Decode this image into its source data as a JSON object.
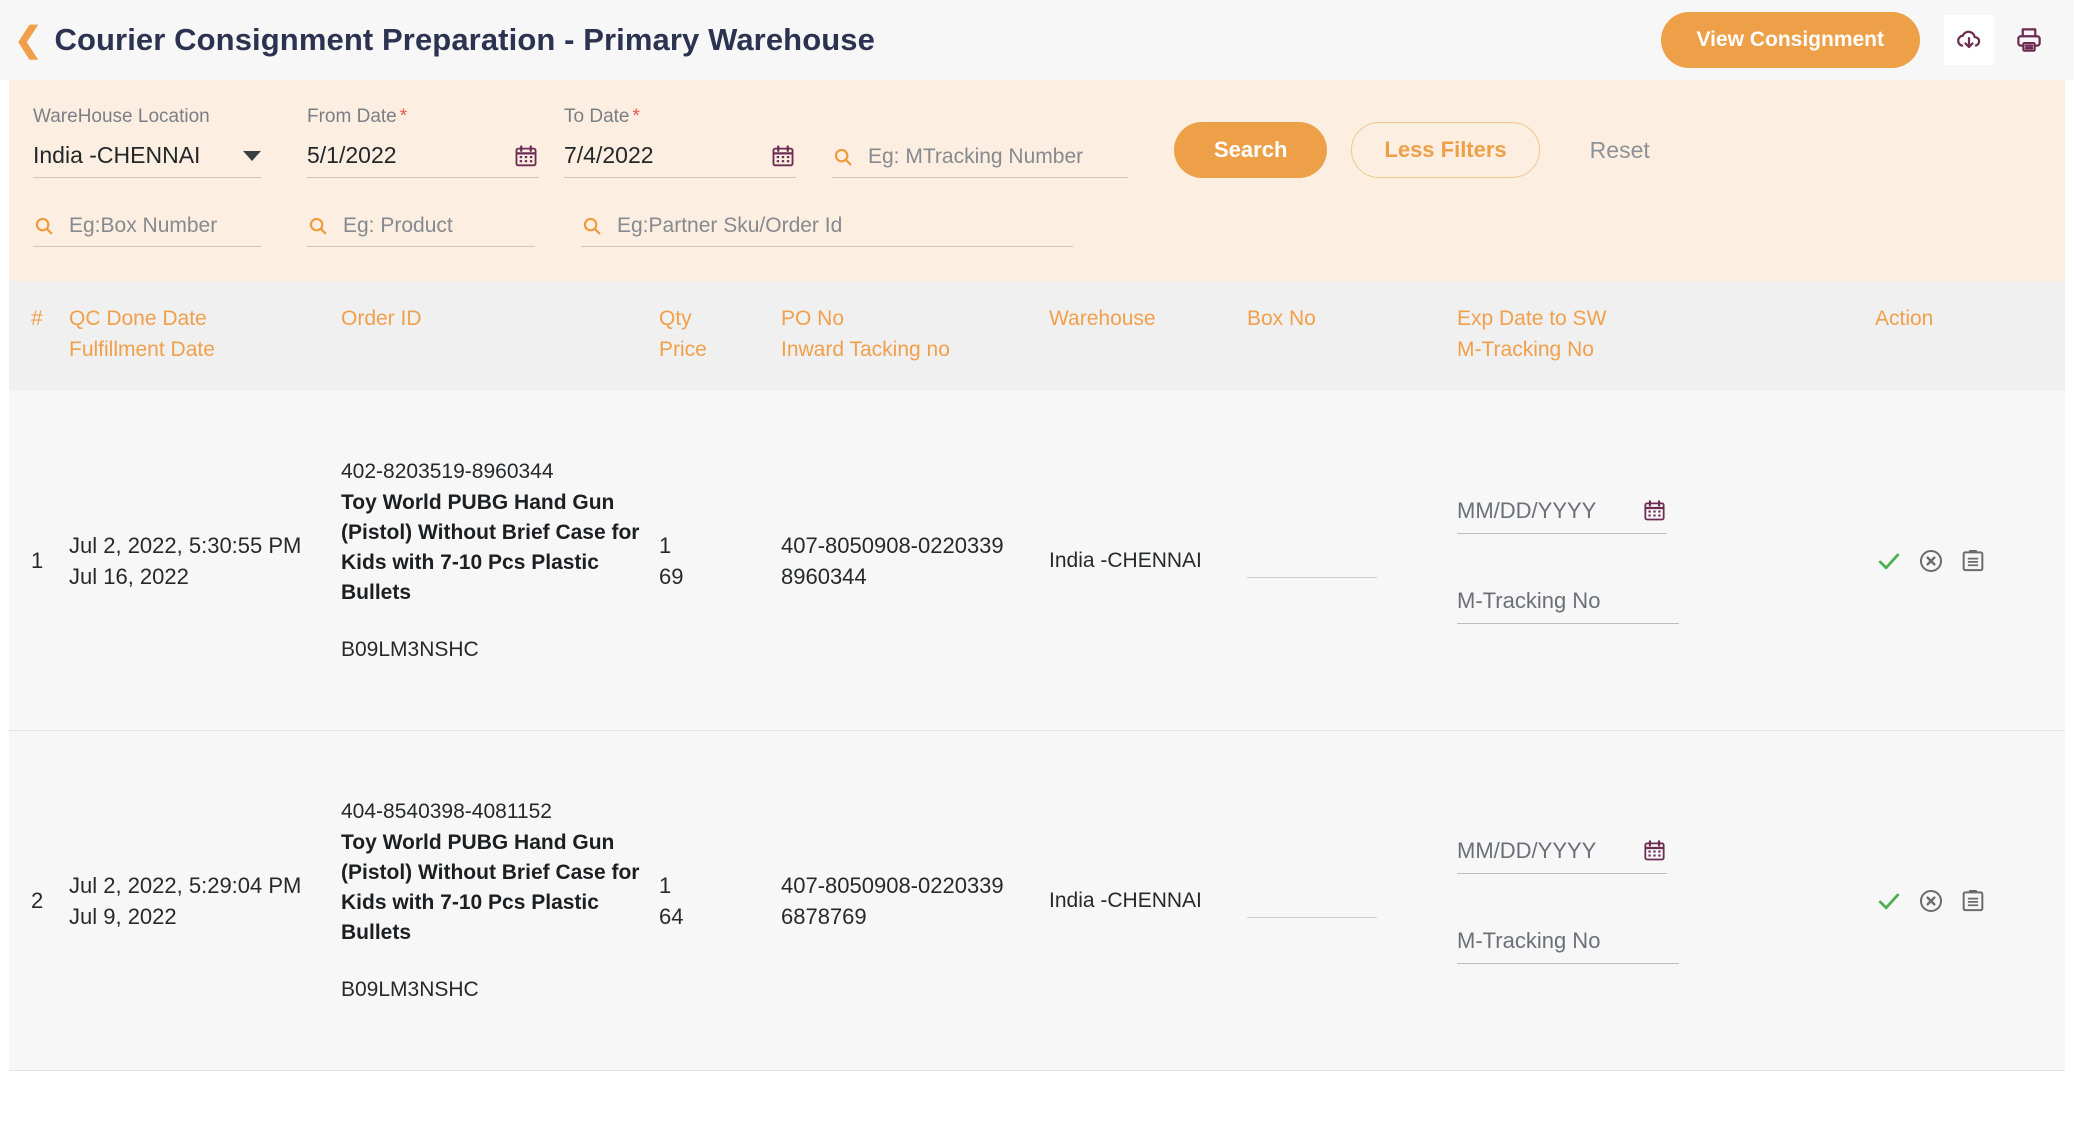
{
  "header": {
    "back_icon": "chevron-left-icon",
    "title": "Courier Consignment Preparation - Primary Warehouse",
    "view_consignment_label": "View Consignment",
    "download_icon": "cloud-download-icon",
    "print_icon": "printer-icon"
  },
  "filters": {
    "warehouse": {
      "label": "WareHouse Location",
      "value": "India -CHENNAI"
    },
    "from_date": {
      "label": "From Date",
      "required": "*",
      "value": "5/1/2022",
      "icon": "calendar-icon"
    },
    "to_date": {
      "label": "To Date",
      "required": "*",
      "value": "7/4/2022",
      "icon": "calendar-icon"
    },
    "mtracking": {
      "placeholder": "Eg: MTracking Number",
      "icon": "search-icon"
    },
    "box_number": {
      "placeholder": "Eg:Box Number",
      "icon": "search-icon"
    },
    "product": {
      "placeholder": "Eg: Product",
      "icon": "search-icon"
    },
    "partner_sku": {
      "placeholder": "Eg:Partner Sku/Order Id",
      "icon": "search-icon"
    },
    "search_label": "Search",
    "less_filters_label": "Less Filters",
    "reset_label": "Reset"
  },
  "table": {
    "columns": {
      "index": "#",
      "qc_done_date": "QC Done Date",
      "fulfillment_date": "Fulfillment Date",
      "order_id": "Order ID",
      "qty": "Qty",
      "price": "Price",
      "po_no": "PO No",
      "inward_tracking_no": "Inward Tacking no",
      "warehouse": "Warehouse",
      "box_no": "Box No",
      "exp_date_to_sw": "Exp Date to SW",
      "m_tracking_no": "M-Tracking No",
      "action": "Action"
    },
    "row_inputs": {
      "exp_date_placeholder": "MM/DD/YYYY",
      "exp_date_icon": "calendar-icon",
      "m_tracking_placeholder": "M-Tracking No"
    },
    "row_actions": {
      "approve_icon": "check-icon",
      "cancel_icon": "circle-x-icon",
      "notes_icon": "clipboard-icon"
    },
    "rows": [
      {
        "index": "1",
        "qc_done_date": "Jul 2, 2022, 5:30:55 PM",
        "fulfillment_date": "Jul 16, 2022",
        "order_id": "402-8203519-8960344",
        "product_name": "Toy World PUBG Hand Gun (Pistol) Without Brief Case for Kids with 7-10 Pcs Plastic Bullets",
        "sku": "B09LM3NSHC",
        "qty": "1",
        "price": "69",
        "po_no": "407-8050908-0220339",
        "inward_tracking_no": "8960344",
        "warehouse": "India -CHENNAI",
        "box_no": ""
      },
      {
        "index": "2",
        "qc_done_date": "Jul 2, 2022, 5:29:04 PM",
        "fulfillment_date": "Jul 9, 2022",
        "order_id": "404-8540398-4081152",
        "product_name": "Toy World PUBG Hand Gun (Pistol) Without Brief Case for Kids with 7-10 Pcs Plastic Bullets",
        "sku": "B09LM3NSHC",
        "qty": "1",
        "price": "64",
        "po_no": "407-8050908-0220339",
        "inward_tracking_no": "6878769",
        "warehouse": "India -CHENNAI",
        "box_no": ""
      }
    ]
  },
  "colors": {
    "accent_orange": "#eea049",
    "header_orange": "#f0a04b",
    "title_navy": "#2b3350",
    "filter_bg": "#fcefe1",
    "table_header_bg": "#f0f0f0",
    "row_bg": "#f7f7f7",
    "required_red": "#ef5350",
    "icon_purple": "#6d2c52",
    "check_green": "#4caf50",
    "muted_gray": "#7a7f87"
  }
}
